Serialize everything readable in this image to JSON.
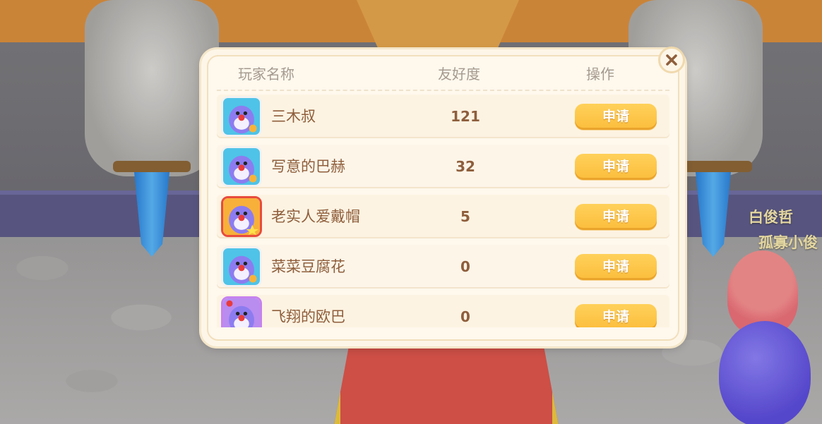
{
  "scene": {
    "name_tags": [
      "白俊哲",
      "孤寡小俊"
    ]
  },
  "dialog": {
    "close_icon": "close-icon",
    "columns": {
      "name": "玩家名称",
      "friendship": "友好度",
      "action": "操作"
    },
    "rows": [
      {
        "name": "三木叔",
        "friendship": "121",
        "button": "申请",
        "avatar_frame": "plain"
      },
      {
        "name": "写意的巴赫",
        "friendship": "32",
        "button": "申请",
        "avatar_frame": "plain"
      },
      {
        "name": "老实人爱戴帽",
        "friendship": "5",
        "button": "申请",
        "avatar_frame": "red"
      },
      {
        "name": "菜菜豆腐花",
        "friendship": "0",
        "button": "申请",
        "avatar_frame": "plain"
      },
      {
        "name": "飞翔的欧巴",
        "friendship": "0",
        "button": "申请",
        "avatar_frame": "purple"
      }
    ]
  },
  "colors": {
    "dialog_bg": "#fdf6e8",
    "button": "#fbbd3c",
    "name_text": "#8e5e3c",
    "header_text": "#a59a8f"
  }
}
